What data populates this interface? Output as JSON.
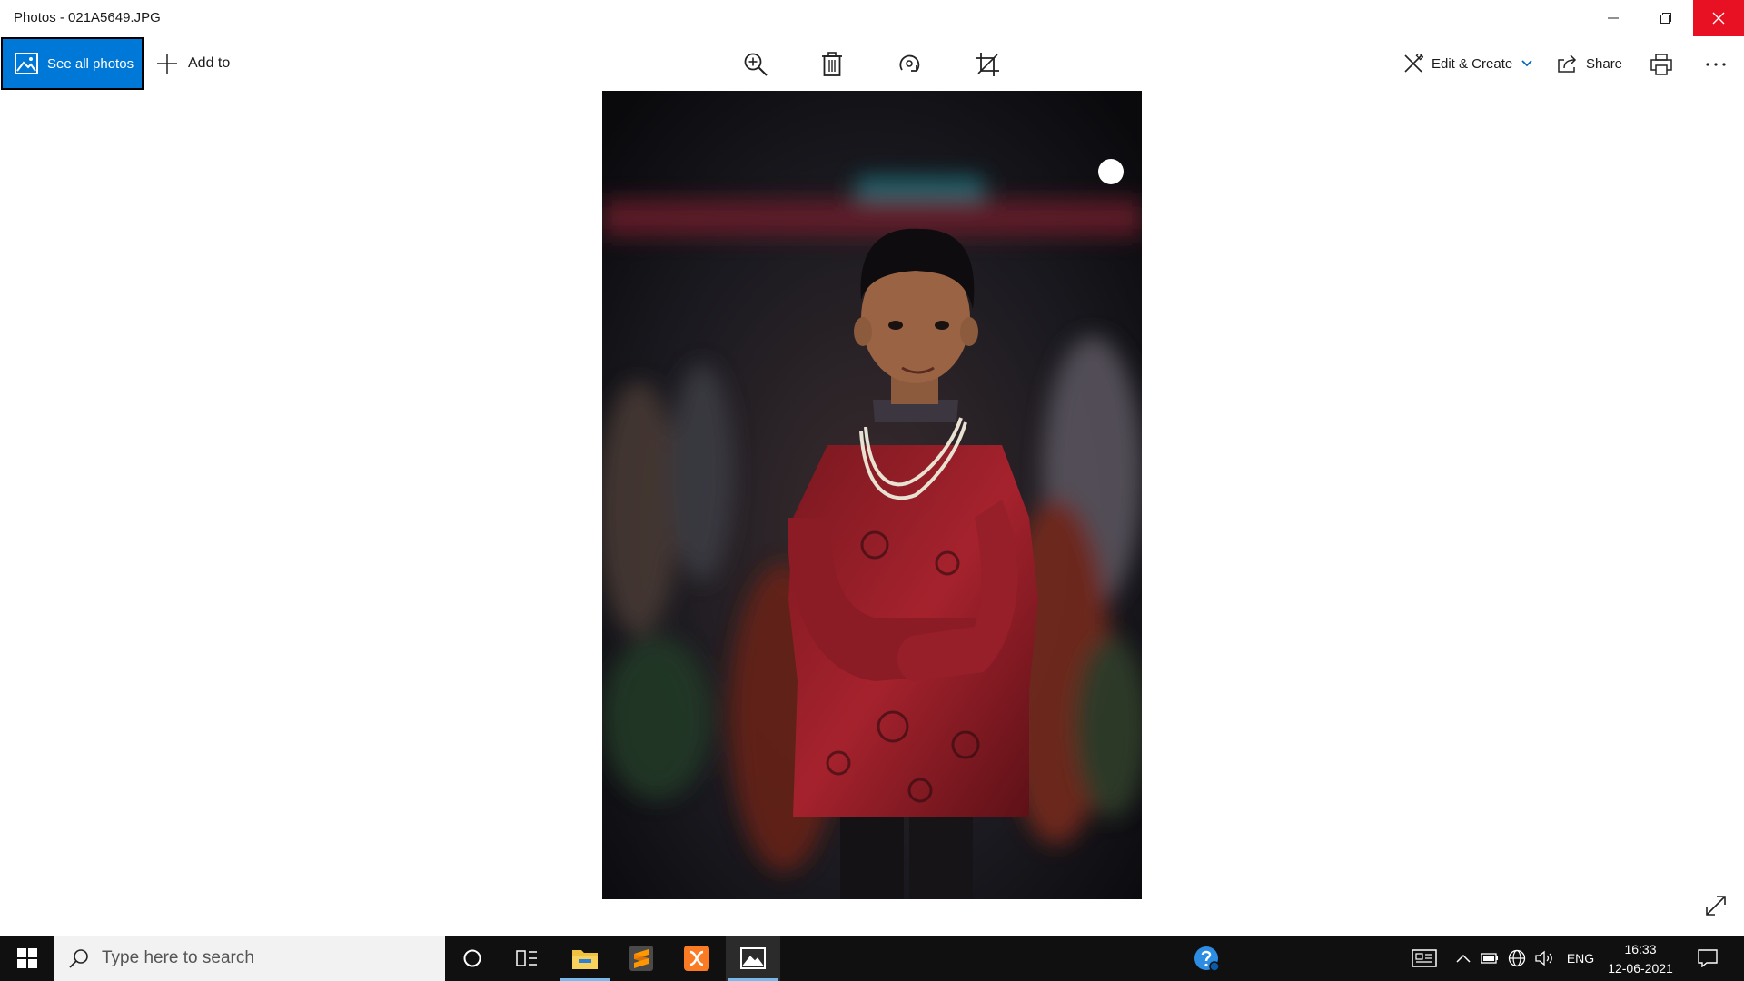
{
  "window": {
    "title": "Photos - 021A5649.JPG"
  },
  "toolbar": {
    "see_all_label": "See all photos",
    "add_to_label": "Add to",
    "edit_create_label": "Edit & Create",
    "share_label": "Share"
  },
  "taskbar": {
    "search_placeholder": "Type here to search",
    "language": "ENG",
    "time": "16:33",
    "date": "12-06-2021"
  },
  "colors": {
    "accent": "#0078d7",
    "close_red": "#e81123",
    "taskbar": "#101010"
  }
}
